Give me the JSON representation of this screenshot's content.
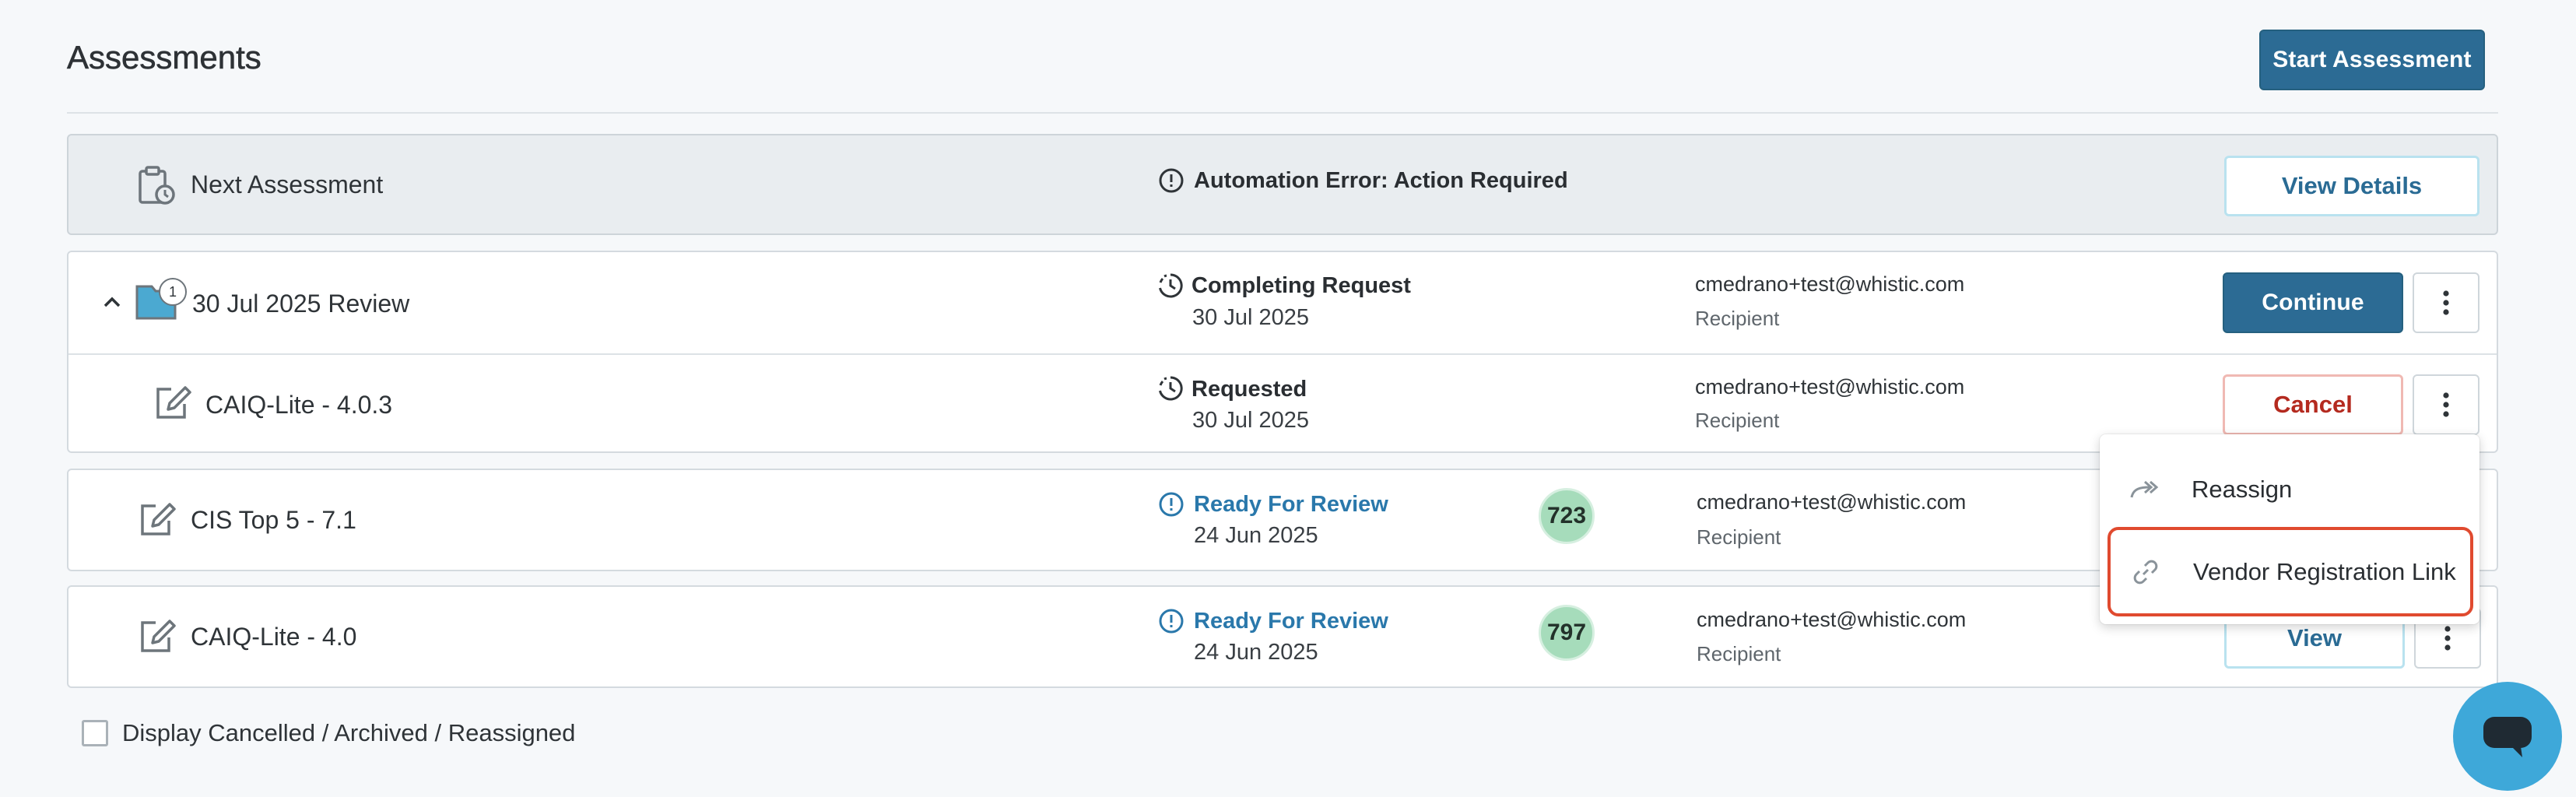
{
  "header": {
    "title": "Assessments",
    "start_button": "Start Assessment"
  },
  "next_assessment": {
    "label": "Next Assessment",
    "alert": "Automation Error: Action Required",
    "details_button": "View Details"
  },
  "group": {
    "badge_count": "1",
    "name": "30 Jul 2025 Review",
    "status": "Completing Request",
    "date": "30 Jul 2025",
    "email": "cmedrano+test@whistic.com",
    "role": "Recipient",
    "action_button": "Continue",
    "child": {
      "name": "CAIQ-Lite - 4.0.3",
      "status": "Requested",
      "date": "30 Jul 2025",
      "email": "cmedrano+test@whistic.com",
      "role": "Recipient",
      "action_button": "Cancel"
    }
  },
  "rows": [
    {
      "name": "CIS Top 5 - 7.1",
      "status": "Ready For Review",
      "date": "24 Jun 2025",
      "score": "723",
      "email": "cmedrano+test@whistic.com",
      "role": "Recipient"
    },
    {
      "name": "CAIQ-Lite - 4.0",
      "status": "Ready For Review",
      "date": "24 Jun 2025",
      "score": "797",
      "email": "cmedrano+test@whistic.com",
      "role": "Recipient",
      "action_button": "View"
    }
  ],
  "context_menu": {
    "items": [
      {
        "label": "Reassign",
        "icon": "reassign-arrow-icon"
      },
      {
        "label": "Vendor Registration Link",
        "icon": "link-icon"
      }
    ]
  },
  "footer": {
    "checkbox_label": "Display Cancelled / Archived / Reassigned",
    "checkbox_checked": false
  },
  "colors": {
    "primary": "#2c6b94",
    "review_blue": "#2a78ab",
    "cancel_red": "#b42a1f",
    "score_green": "#a6dcbb",
    "highlight_red": "#e04a2f",
    "chat_blue": "#3ea8d9"
  }
}
